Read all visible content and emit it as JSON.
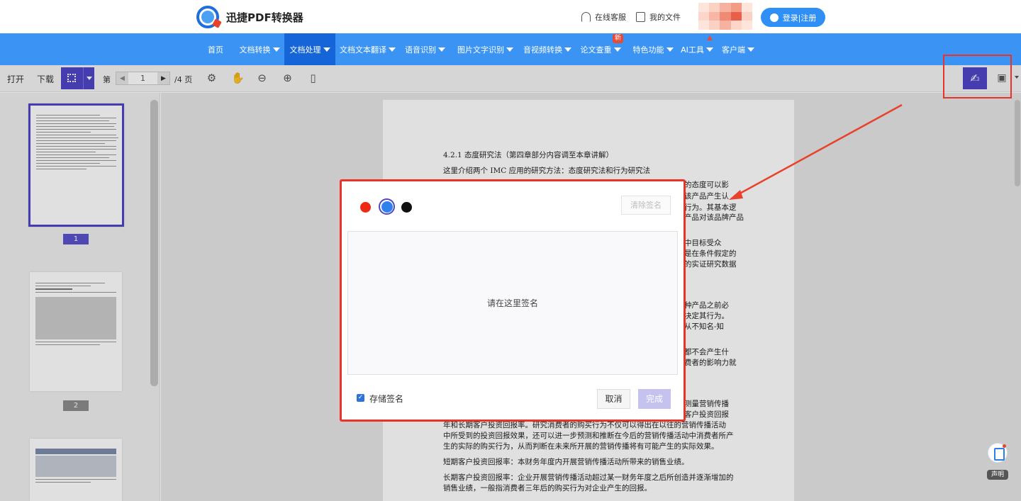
{
  "header": {
    "logo_text": "迅捷PDF转换器",
    "service_link": "在线客服",
    "files_link": "我的文件",
    "login_label": "登录|注册"
  },
  "nav": {
    "items": [
      {
        "label": "首页"
      },
      {
        "label": "文档转换"
      },
      {
        "label": "文档处理"
      },
      {
        "label": "文档文本翻译"
      },
      {
        "label": "语音识别"
      },
      {
        "label": "图片文字识别"
      },
      {
        "label": "音视频转换"
      },
      {
        "label": "论文查重"
      },
      {
        "label": "特色功能"
      },
      {
        "label": "AI工具"
      },
      {
        "label": "客户端"
      }
    ],
    "new_badge": "新"
  },
  "toolbar": {
    "open_label": "打开",
    "download_label": "下载",
    "page_prefix": "第",
    "page_value": "1",
    "page_total": "/4 页"
  },
  "sidebar": {
    "page_numbers": [
      "1",
      "2"
    ]
  },
  "document": {
    "lines": [
      "4.2.1 态度研究法（第四章部分内容调至本章讲解）",
      "这里介绍两个 IMC 应用的研究方法：态度研究法和行为研究法",
      "的态度可以影",
      "该产品产生认",
      "行为。其基本逻",
      "产品对该品牌产品",
      "中目标受众",
      "是在条件假定的",
      "的实证研究数据",
      "种产品之前必",
      "决定其行为。",
      "从不知名-知",
      "都不会产生什",
      "费者的影响力就",
      "测量营销传播",
      "客户投资回报",
      "年和长期客户投资回报率。研究消费者的购买行为不仅可以得出在以往的营销传播活动",
      "中所受到的投资回报效果，还可以进一步预测和推断在今后的营销传播活动中消费者所产",
      "生的实际的购买行为，从而判断在未来所开展的营销传播将有可能产生的实际效果。",
      "短期客户投资回报率：本财务年度内开展营销传播活动所带来的销售业绩。",
      "长期客户投资回报率：企业开展营销传播活动超过某一财务年度之后所创造并逐渐增加的",
      "销售业绩，一般指消费者三年后的购买行为对企业产生的回报。"
    ]
  },
  "modal": {
    "colors": [
      "#ee2b12",
      "#2f80ed",
      "#111111"
    ],
    "selected_color": "#2f80ed",
    "clear_label": "清除签名",
    "sign_placeholder": "请在这里签名",
    "save_label": "存储签名",
    "save_checked": true,
    "cancel_label": "取消",
    "done_label": "完成"
  },
  "floating": {
    "declaration_label": "声明"
  }
}
